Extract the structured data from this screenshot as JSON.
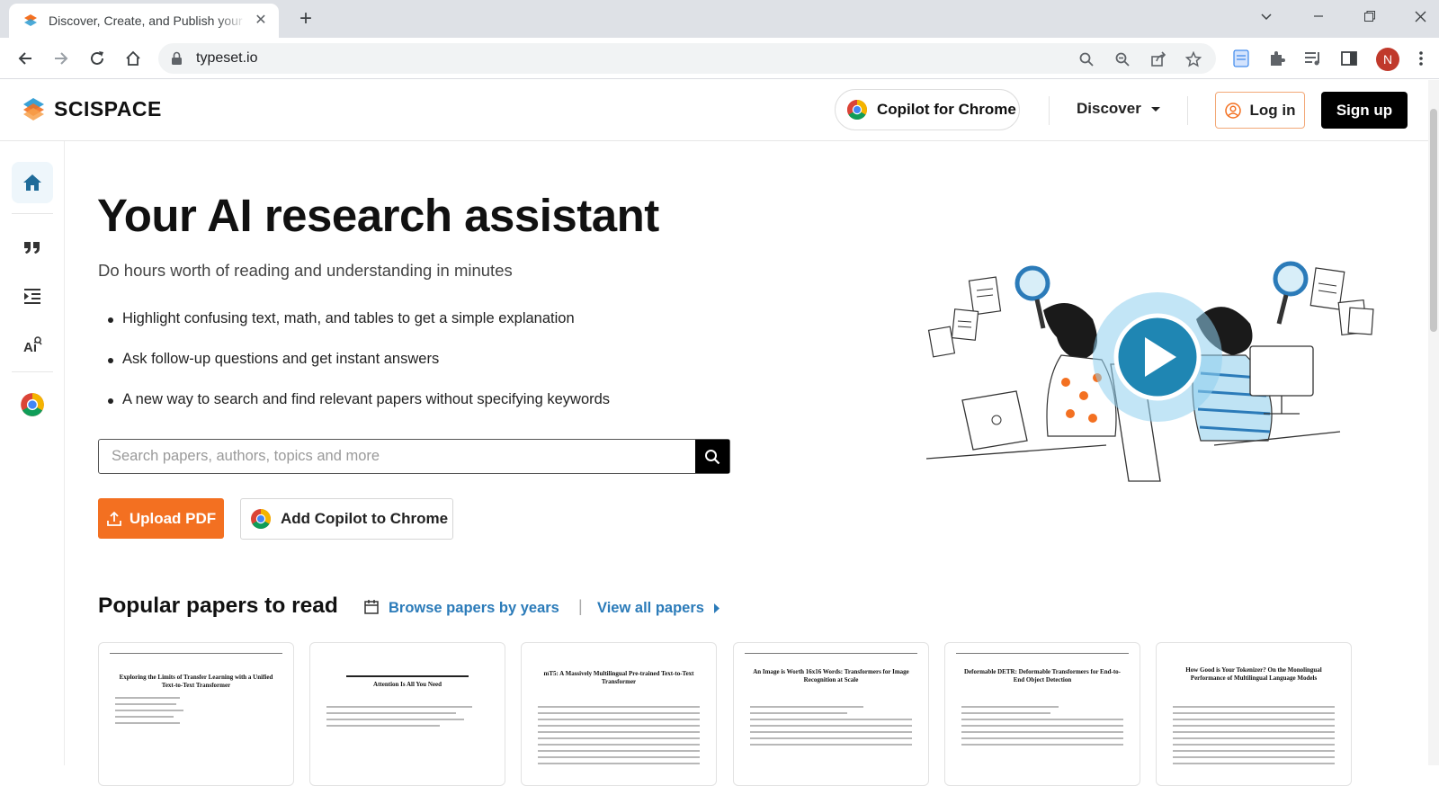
{
  "browser": {
    "tab_title": "Discover, Create, and Publish your research paper | SciSpace",
    "url": "typeset.io",
    "profile_initial": "N",
    "new_tab_label": "+"
  },
  "header": {
    "logo_text": "SCISPACE",
    "copilot_label": "Copilot for Chrome",
    "discover_label": "Discover",
    "login_label": "Log in",
    "signup_label": "Sign up"
  },
  "sidebar": {
    "items": [
      {
        "icon": "home-icon"
      },
      {
        "icon": "quote-icon"
      },
      {
        "icon": "indent-list-icon"
      },
      {
        "icon": "ai-search-icon"
      },
      {
        "icon": "chrome-icon"
      }
    ]
  },
  "hero": {
    "title": "Your AI research assistant",
    "subtitle": "Do hours worth of reading and understanding in minutes",
    "bullets": [
      "Highlight confusing text, math, and tables to get a simple explanation",
      "Ask follow-up questions and get instant answers",
      "A new way to search and find relevant papers without specifying keywords"
    ],
    "search_placeholder": "Search papers, authors, topics and more",
    "upload_label": "Upload PDF",
    "add_copilot_label": "Add Copilot to Chrome"
  },
  "popular": {
    "title": "Popular papers to read",
    "browse_label": "Browse papers by years",
    "separator": "|",
    "view_all_label": "View all papers",
    "papers": [
      {
        "title": "Exploring the Limits of Transfer Learning with a Unified Text-to-Text Transformer"
      },
      {
        "title": "Attention Is All You Need"
      },
      {
        "title": "mT5: A Massively Multilingual Pre-trained Text-to-Text Transformer"
      },
      {
        "title": "An Image is Worth 16x16 Words: Transformers for Image Recognition at Scale"
      },
      {
        "title": "Deformable DETR: Deformable Transformers for End-to-End Object Detection"
      },
      {
        "title": "How Good is Your Tokenizer? On the Monolingual Performance of Multilingual Language Models"
      }
    ]
  },
  "colors": {
    "accent_orange": "#f37021",
    "link_blue": "#2b7bb9",
    "brand_black": "#000000"
  }
}
